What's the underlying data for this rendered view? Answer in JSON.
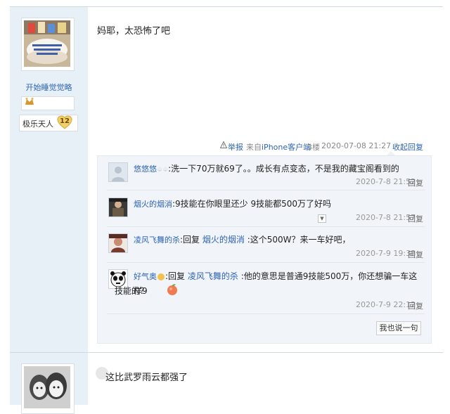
{
  "post1": {
    "author": "开始睡觉觉略",
    "level_title": "极乐天人",
    "level_num": "12",
    "content": "妈耶，太恐怖了吧",
    "tail": {
      "report": "举报",
      "source_prefix": "来自",
      "source_link": "iPhone客户端",
      "floor": "3楼",
      "time": "2020-07-08 21:27",
      "reply_toggle": "收起回复"
    }
  },
  "replies": [
    {
      "name": "悠悠悠",
      "name_suffix": "♤♤",
      "text": ":洗一下70万就69了。。成长有点变态，不是我的藏宝阁看到的",
      "time": "2020-7-8 21:52",
      "reply": "回复"
    },
    {
      "name": "烟火的烟消",
      "text": ":9技能在你眼里还少 9技能都500万了好吗",
      "time": "2020-7-8 21:57",
      "reply": "回复"
    },
    {
      "name": "凌风飞舞的杀",
      "text_prefix": ":回复",
      "target": "烟火的烟消",
      "text": " :这个500W？来一车好吧，",
      "time": "2020-7-9 19:38",
      "reply": "回复"
    },
    {
      "name": "好气奥",
      "text_prefix": ":回复",
      "target": "凌风飞舞的杀",
      "text_line1": " :他的意思是普通9技能500万，你还想骗一车这样9",
      "text_line2": "技能的？",
      "time": "2020-7-9 22:12",
      "reply": "回复"
    }
  ],
  "reply_button": "我也说一句",
  "post2": {
    "content": "这比武罗雨云都强了"
  },
  "icons": {
    "report": "warning-icon",
    "medal": "medal-icon",
    "level": "heart-badge-icon",
    "dropdown": "dropdown-icon",
    "emoji": "peach-emoji-icon"
  },
  "colors": {
    "link": "#2d64b3",
    "author_bg": "#e8f0f7",
    "reply_bg": "#f1f4f8",
    "level_badge": "#f3cf6b"
  }
}
